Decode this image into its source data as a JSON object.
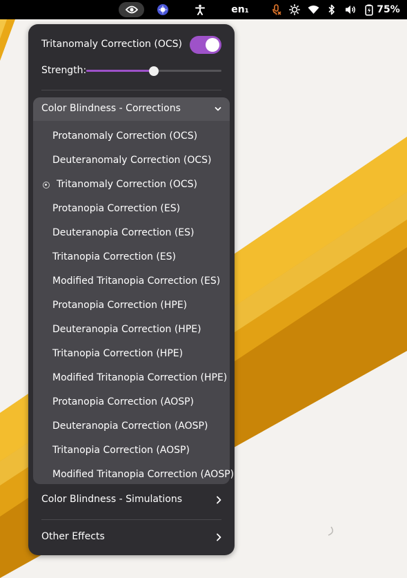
{
  "topbar": {
    "keyboard_layout": "en₁",
    "battery_percent": "75%",
    "icons": [
      "eye-icon",
      "app-indicator-icon",
      "accessibility-icon",
      "microphone-muted-icon",
      "brightness-icon",
      "wifi-icon",
      "bluetooth-icon",
      "volume-icon",
      "battery-icon"
    ]
  },
  "menu": {
    "toggle": {
      "label": "Tritanomaly Correction (OCS)",
      "on": true
    },
    "strength": {
      "label": "Strength:",
      "value": 0.5
    },
    "corrections": {
      "header": "Color Blindness - Corrections",
      "items": [
        {
          "label": "Protanomaly Correction (OCS)",
          "selected": false
        },
        {
          "label": "Deuteranomaly Correction (OCS)",
          "selected": false
        },
        {
          "label": "Tritanomaly Correction (OCS)",
          "selected": true
        },
        {
          "label": "Protanopia Correction (ES)",
          "selected": false
        },
        {
          "label": "Deuteranopia Correction (ES)",
          "selected": false
        },
        {
          "label": "Tritanopia Correction (ES)",
          "selected": false
        },
        {
          "label": "Modified Tritanopia Correction (ES)",
          "selected": false
        },
        {
          "label": "Protanopia Correction (HPE)",
          "selected": false
        },
        {
          "label": "Deuteranopia Correction (HPE)",
          "selected": false
        },
        {
          "label": "Tritanopia Correction (HPE)",
          "selected": false
        },
        {
          "label": "Modified Tritanopia Correction (HPE)",
          "selected": false
        },
        {
          "label": "Protanopia Correction (AOSP)",
          "selected": false
        },
        {
          "label": "Deuteranopia Correction (AOSP)",
          "selected": false
        },
        {
          "label": "Tritanopia Correction (AOSP)",
          "selected": false
        },
        {
          "label": "Modified Tritanopia Correction (AOSP)",
          "selected": false
        }
      ]
    },
    "simulations": {
      "label": "Color Blindness - Simulations"
    },
    "other_effects": {
      "label": "Other Effects"
    }
  },
  "colors": {
    "accent": "#9e52c9",
    "menu_bg": "#2e2d31",
    "submenu_bg": "#48474c"
  }
}
